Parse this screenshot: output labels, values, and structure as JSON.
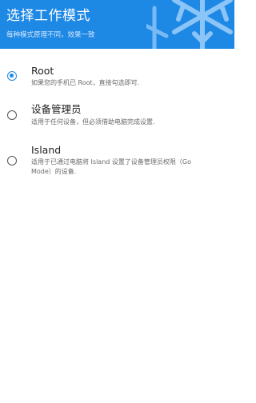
{
  "header": {
    "title": "选择工作模式",
    "subtitle": "每种模式原理不同，效果一致",
    "background_color": "#1e88e5",
    "decoration_icon": "snowflake-icon"
  },
  "options": [
    {
      "title": "Root",
      "description": "如果您的手机已 Root，直接勾选即可.",
      "selected": true
    },
    {
      "title": "设备管理员",
      "description": "适用于任何设备，但必须借助电脑完成设置.",
      "selected": false
    },
    {
      "title": "Island",
      "description_line1": "适用于已通过电脑将 Island 设置了设备管理员权限（Go",
      "description_line2": "Mode）的设备.",
      "selected": false
    }
  ],
  "accent_color": "#1e88e5"
}
